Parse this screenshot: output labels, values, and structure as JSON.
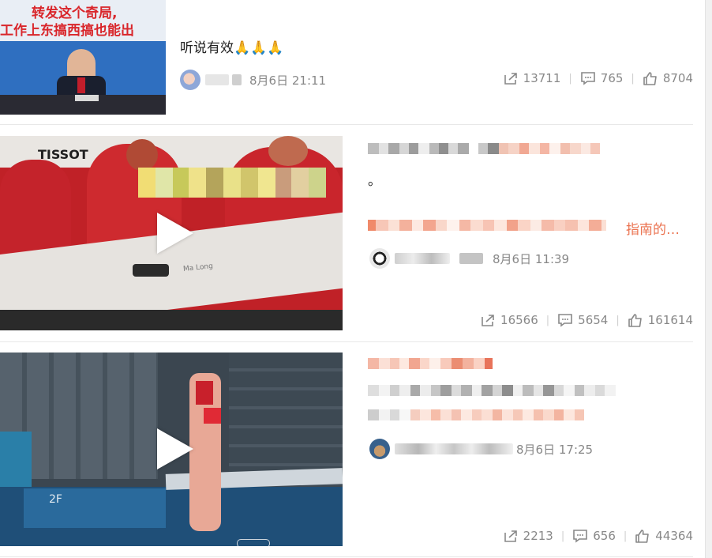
{
  "posts": [
    {
      "thumb_caption_1": "转发这个奇局,",
      "thumb_caption_2": "工作上东搞西搞也能出",
      "text": "听说有效🙏🙏🙏",
      "date": "8月6日 21:11",
      "shares": "13711",
      "comments": "765",
      "likes": "8704"
    },
    {
      "thumb_sign": "TISSOT",
      "thumb_nameplate": "Ma Long",
      "text_line2": "。",
      "text_tail": "指南的…",
      "date": "8月6日 11:39",
      "shares": "16566",
      "comments": "5654",
      "likes": "161614"
    },
    {
      "thumb_board": "2F",
      "date": "8月6日 17:25",
      "shares": "2213",
      "comments": "656",
      "likes": "44364"
    }
  ],
  "colors": {
    "accent_orange": "#eb7350",
    "meta_gray": "#888888"
  },
  "icons": {
    "share": "share-icon",
    "comment": "comment-icon",
    "like": "like-icon",
    "play": "play-icon"
  }
}
